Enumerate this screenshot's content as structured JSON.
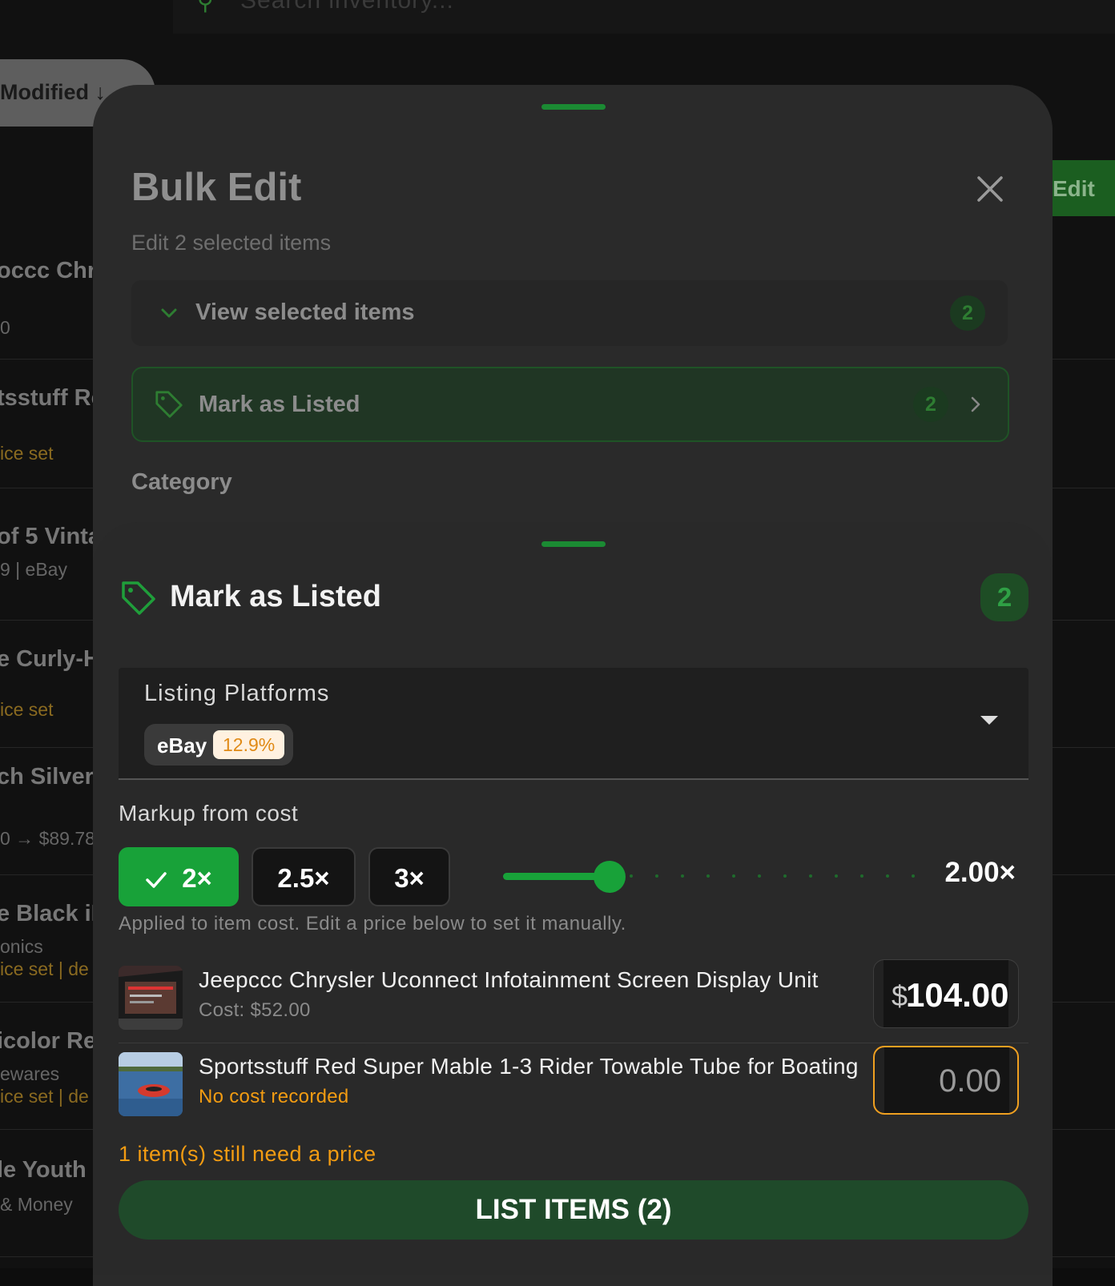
{
  "background": {
    "search_placeholder": "Search inventory...",
    "sort_label": "Modified ↓",
    "edit_button": "Edit",
    "rows": [
      {
        "title": "occc Chrys",
        "sub": "0",
        "sub_warn": false
      },
      {
        "title": "tsstuff Re",
        "sub": "ice set",
        "sub_warn": true
      },
      {
        "title": "of 5 Vinta",
        "sub": "9 | eBay",
        "sub_warn": false
      },
      {
        "title": "e Curly-H",
        "sub": "ice set",
        "sub_warn": true
      },
      {
        "title": "ch Silver S",
        "sub": "0 → $89.78",
        "sub_warn": false
      },
      {
        "title": "e Black iP",
        "sub": "onics",
        "sub2": "ice set | de",
        "sub_warn": false
      },
      {
        "title": "icolor Res",
        "sub": "ewares",
        "sub2": "ice set | de",
        "sub_warn": false
      },
      {
        "title": "le Youth I",
        "sub": "& Money",
        "sub_warn": false
      }
    ]
  },
  "bulk_edit": {
    "title": "Bulk Edit",
    "subtitle": "Edit 2 selected items",
    "view_selected_label": "View selected items",
    "view_selected_count": "2",
    "mark_listed_label": "Mark as Listed",
    "mark_listed_count": "2",
    "category_label": "Category"
  },
  "mark_listed": {
    "title": "Mark as Listed",
    "count": "2",
    "platforms_label": "Listing Platforms",
    "platform": {
      "name": "eBay",
      "fee": "12.9%"
    },
    "markup_label": "Markup from cost",
    "markup_options": [
      "2×",
      "2.5×",
      "3×"
    ],
    "markup_selected_index": 0,
    "markup_value_text": "2.00×",
    "markup_slider_fraction": 0.26,
    "hint": "Applied to item cost. Edit a price below to set it manually.",
    "items": [
      {
        "name": "Jeepccc Chrysler Uconnect Infotainment Screen Display Unit",
        "cost": "Cost: $52.00",
        "currency": "$",
        "price": "104.00"
      },
      {
        "name": "Sportsstuff Red Super Mable 1-3 Rider Towable Tube for Boating",
        "cost": "No cost recorded",
        "price_placeholder": "0.00"
      }
    ],
    "warning": "1 item(s) still need a price",
    "list_button": "LIST ITEMS (2)"
  },
  "colors": {
    "accent": "#18a239",
    "warning": "#f39c12",
    "sheet": "#292929"
  }
}
